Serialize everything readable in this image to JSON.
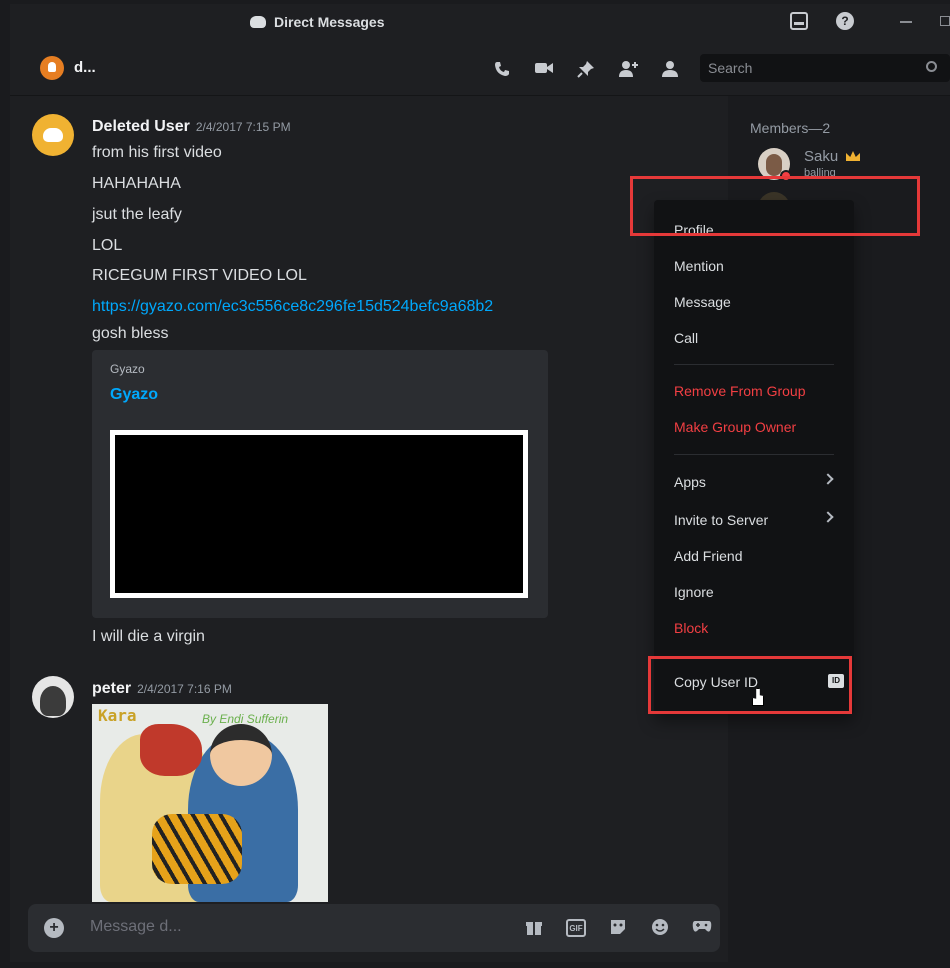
{
  "titlebar": {
    "title": "Direct Messages"
  },
  "header": {
    "channel_name": "d...",
    "search_placeholder": "Search"
  },
  "messages": [
    {
      "author": "Deleted User",
      "timestamp": "2/4/2017 7:15 PM",
      "lines": [
        "from his first video",
        "HAHAHAHA",
        "jsut the leafy",
        "LOL",
        "RICEGUM FIRST VIDEO LOL"
      ],
      "link": "https://gyazo.com/ec3c556ce8c296fe15d524befc9a68b2",
      "after_link": "gosh bless",
      "embed": {
        "provider": "Gyazo",
        "title": "Gyazo"
      },
      "after_embed": "I will die a virgin"
    },
    {
      "author": "peter",
      "timestamp": "2/4/2017 7:16 PM",
      "image_text": {
        "title": "Kara",
        "byline": "By Endi Sufferin"
      }
    }
  ],
  "composer": {
    "placeholder": "Message d...",
    "gif_label": "GIF"
  },
  "members": {
    "heading": "Members—2",
    "list": [
      {
        "name": "Saku",
        "status": "balling",
        "owner": true,
        "presence": "dnd"
      }
    ]
  },
  "context_menu": {
    "items": {
      "profile": "Profile",
      "mention": "Mention",
      "message": "Message",
      "call": "Call",
      "remove": "Remove From Group",
      "make_owner": "Make Group Owner",
      "apps": "Apps",
      "invite": "Invite to Server",
      "add_friend": "Add Friend",
      "ignore": "Ignore",
      "block": "Block",
      "copy_id": "Copy User ID"
    },
    "id_badge": "ID"
  },
  "colors": {
    "accent_link": "#00a8fc",
    "danger": "#f23f43",
    "highlight": "#e53939",
    "owner_crown": "#f0b232"
  }
}
